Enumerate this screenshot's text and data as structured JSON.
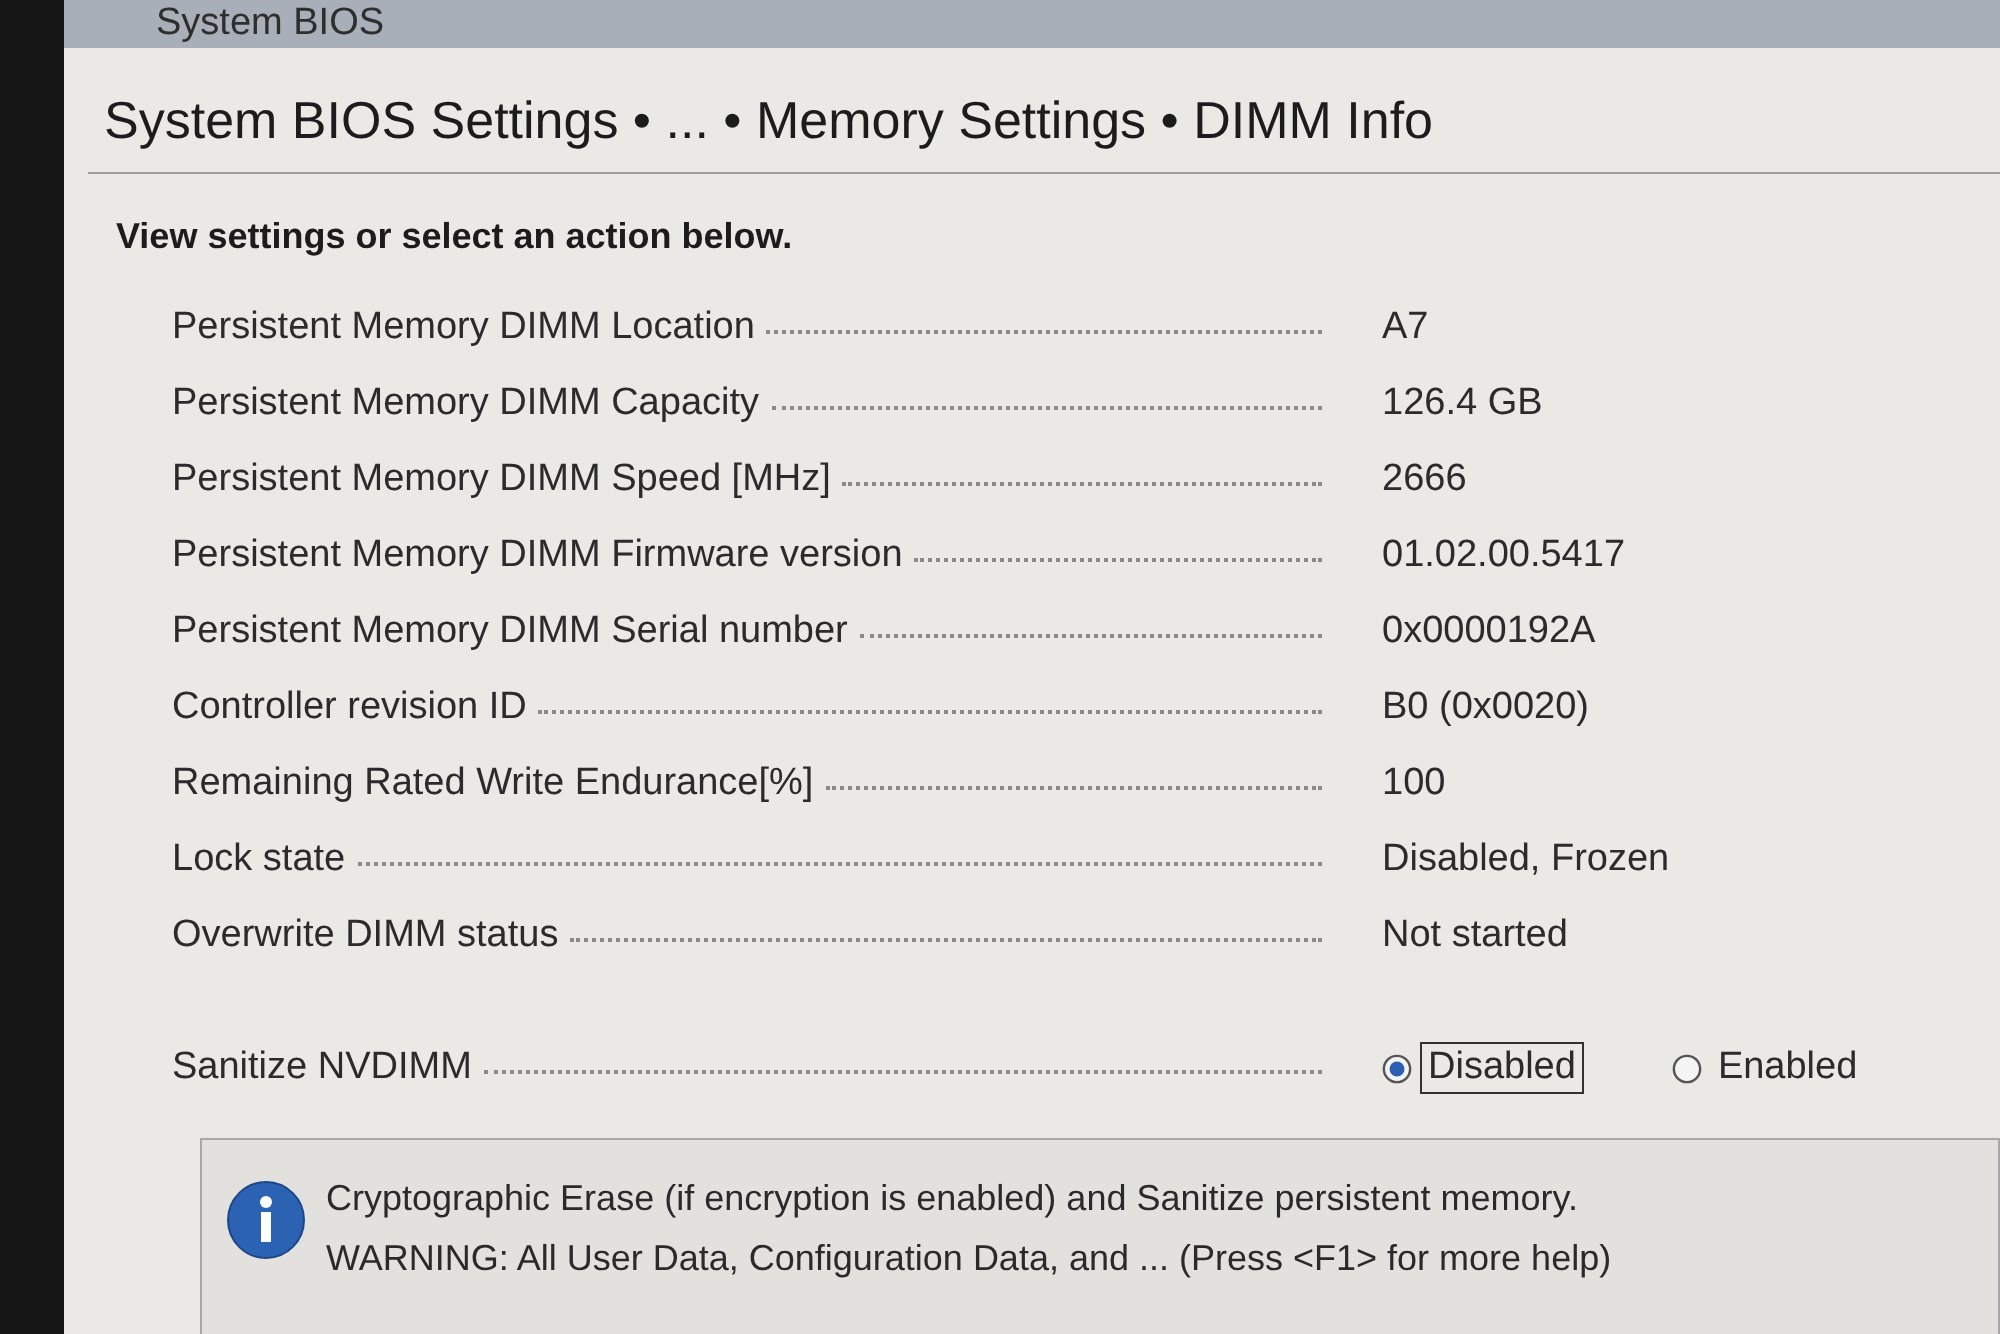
{
  "header": {
    "title": "System BIOS"
  },
  "breadcrumb": "System BIOS Settings • ... • Memory Settings • DIMM Info",
  "instruction": "View settings or select an action below.",
  "settings": [
    {
      "kind": "info",
      "label": "Persistent Memory DIMM Location",
      "value": "A7"
    },
    {
      "kind": "info",
      "label": "Persistent Memory DIMM Capacity",
      "value": "126.4 GB"
    },
    {
      "kind": "info",
      "label": "Persistent Memory DIMM Speed [MHz]",
      "value": "2666"
    },
    {
      "kind": "info",
      "label": "Persistent Memory DIMM Firmware version",
      "value": "01.02.00.5417"
    },
    {
      "kind": "info",
      "label": "Persistent Memory DIMM Serial number",
      "value": "0x0000192A"
    },
    {
      "kind": "info",
      "label": "Controller revision ID",
      "value": "B0 (0x0020)"
    },
    {
      "kind": "info",
      "label": "Remaining Rated Write Endurance[%]",
      "value": "100"
    },
    {
      "kind": "info",
      "label": "Lock state",
      "value": "Disabled, Frozen"
    },
    {
      "kind": "info",
      "label": "Overwrite DIMM status",
      "value": "Not started"
    },
    {
      "kind": "radio",
      "label": "Sanitize NVDIMM",
      "options": [
        {
          "label": "Disabled",
          "selected": true,
          "focused": true
        },
        {
          "label": "Enabled",
          "selected": false,
          "focused": false
        }
      ]
    }
  ],
  "help": {
    "lines": [
      "Cryptographic Erase (if encryption is enabled) and Sanitize persistent memory.",
      "WARNING: All User Data, Configuration Data, and ... (Press <F1> for more help)"
    ]
  }
}
